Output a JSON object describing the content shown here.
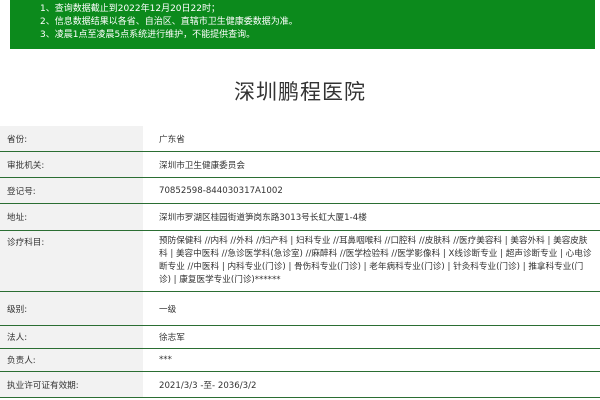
{
  "notice": {
    "lines": [
      "1、查询数据截止到2022年12月20日22时；",
      "2、信息数据结果以各省、自治区、直辖市卫生健康委数据为准。",
      "3、凌晨1点至凌晨5点系统进行维护，不能提供查询。"
    ]
  },
  "hospital": {
    "name": "深圳鹏程医院"
  },
  "fields": [
    {
      "label": "省份:",
      "value": "广东省"
    },
    {
      "label": "审批机关:",
      "value": "深圳市卫生健康委员会"
    },
    {
      "label": "登记号:",
      "value": "70852598-844030317A1002"
    },
    {
      "label": "地址:",
      "value": "深圳市罗湖区桂园街道笋岗东路3013号长虹大厦1-4楼"
    },
    {
      "label": "诊疗科目:",
      "value": "预防保健科 //内科 //外科 //妇产科 | 妇科专业 //耳鼻咽喉科 //口腔科 //皮肤科 //医疗美容科 | 美容外科 | 美容皮肤科 | 美容中医科 //急诊医学科(急诊室) //麻醉科 //医学检验科 //医学影像科 | X线诊断专业 | 超声诊断专业 | 心电诊断专业 //中医科 | 内科专业(门诊) | 骨伤科专业(门诊) | 老年病科专业(门诊) | 针灸科专业(门诊) | 推拿科专业(门诊) | 康复医学专业(门诊)******"
    },
    {
      "label": "级别:",
      "value": "一级"
    },
    {
      "label": "法人:",
      "value": "徐志军"
    },
    {
      "label": "负责人:",
      "value": "***"
    },
    {
      "label": "执业许可证有效期:",
      "value": "2021/3/3 -至- 2036/3/2"
    }
  ]
}
